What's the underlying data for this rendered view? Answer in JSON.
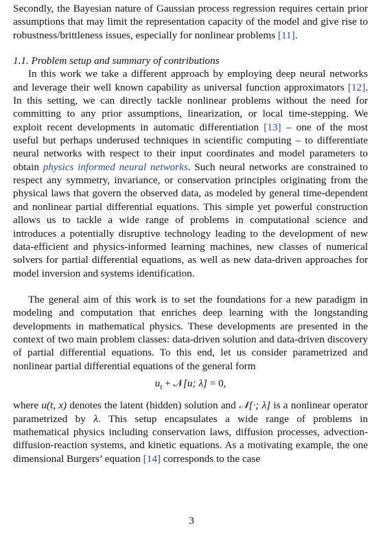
{
  "para_intro": {
    "t1": "Secondly, the Bayesian nature of Gaussian process regression requires certain prior assumptions that may limit the representation capacity of the model and give rise to robustness/brittleness issues, especially for nonlinear problems ",
    "c1": "[11]",
    "t2": "."
  },
  "section": {
    "number": "1.1.",
    "title": "Problem setup and summary of contributions"
  },
  "para_work": {
    "t1": "In this work we take a different approach by employing deep neural networks and leverage their well known capability as universal function approximators ",
    "c1": "[12]",
    "t2": ". In this setting, we can directly tackle nonlinear problems without the need for committing to any prior assumptions, linearization, or local time-stepping. We exploit recent developments in automatic differentiation ",
    "c2": "[13]",
    "t3": " – one of the most useful but perhaps underused techniques in scientific computing – to differentiate neural networks with respect to their input coordinates and model parameters to obtain ",
    "em": "physics informed neural networks",
    "t4": ". Such neural networks are constrained to respect any symmetry, invariance, or conservation principles originating from the physical laws that govern the observed data, as modeled by general time-dependent and nonlinear partial differential equations. This simple yet powerful construction allows us to tackle a wide range of problems in computational science and introduces a potentially disruptive technology leading to the development of new data-efficient and physics-informed learning machines, new classes of numerical solvers for partial differential equations, as well as new data-driven approaches for model inversion and systems identification."
  },
  "para_aim": {
    "t1": "The general aim of this work is to set the foundations for a new paradigm in modeling and computation that enriches deep learning with the longstanding developments in mathematical physics. These developments are presented in the context of two main problem classes: data-driven solution and data-driven discovery of partial differential equations. To this end, let us consider parametrized and nonlinear partial differential equations of the general form"
  },
  "equation": {
    "lhs_u": "u",
    "lhs_sub": "t",
    "plus": " + ",
    "operator": "𝒩",
    "args": "[u; λ]",
    "rhs": " = 0,"
  },
  "para_where": {
    "t1": "where ",
    "m1": "u(t, x)",
    "t2": " denotes the latent (hidden) solution and ",
    "m2": "𝒩[·; λ]",
    "t3": " is a nonlinear operator parametrized by ",
    "m3": "λ",
    "t4": ". This setup encapsulates a wide range of problems in mathematical physics including conservation laws, diffusion processes, advection-diffusion-reaction systems, and kinetic equations. As a motivating example, the one dimensional Burgers’ equation ",
    "c1": "[14]",
    "t5": " corresponds to the case"
  },
  "page_number": "3"
}
